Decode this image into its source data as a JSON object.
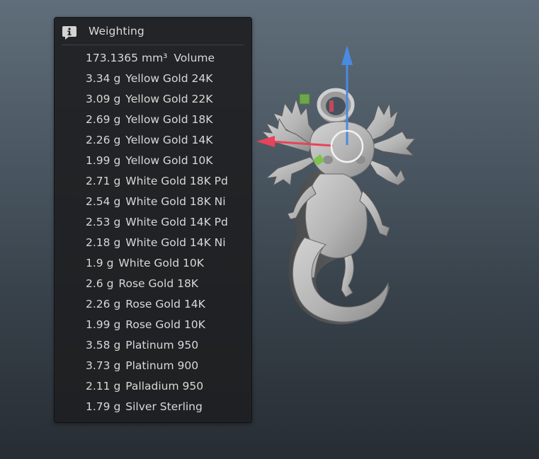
{
  "panel": {
    "title": "Weighting",
    "icon": "info-icon",
    "volume": {
      "value": "173.1365",
      "unit": "mm³",
      "label": "Volume"
    },
    "weights": [
      {
        "value": "3.34 g",
        "material": "Yellow Gold 24K"
      },
      {
        "value": "3.09 g",
        "material": "Yellow Gold 22K"
      },
      {
        "value": "2.69 g",
        "material": "Yellow Gold 18K"
      },
      {
        "value": "2.26 g",
        "material": "Yellow Gold 14K"
      },
      {
        "value": "1.99 g",
        "material": "Yellow Gold 10K"
      },
      {
        "value": "2.71 g",
        "material": "White Gold 18K Pd"
      },
      {
        "value": "2.54 g",
        "material": "White Gold 18K Ni"
      },
      {
        "value": "2.53 g",
        "material": "White Gold 14K Pd"
      },
      {
        "value": "2.18 g",
        "material": "White Gold 14K Ni"
      },
      {
        "value": "1.9 g",
        "material": "White Gold 10K"
      },
      {
        "value": "2.6 g",
        "material": "Rose Gold 18K"
      },
      {
        "value": "2.26 g",
        "material": "Rose Gold 14K"
      },
      {
        "value": "1.99 g",
        "material": "Rose Gold 10K"
      },
      {
        "value": "3.58 g",
        "material": "Platinum 950"
      },
      {
        "value": "3.73 g",
        "material": "Platinum 900"
      },
      {
        "value": "2.11 g",
        "material": "Palladium 950"
      },
      {
        "value": "1.79 g",
        "material": "Silver Sterling"
      }
    ]
  },
  "gizmo": {
    "x_axis_color": "#e8435a",
    "y_axis_color": "#4a8ae0",
    "z_axis_color": "#7cc24a",
    "handle_colors": {
      "green": "#6ea64a",
      "red": "#c24a56"
    }
  },
  "model": {
    "name_hint": "axolotl-pendant",
    "color": "#b8b8b8"
  }
}
